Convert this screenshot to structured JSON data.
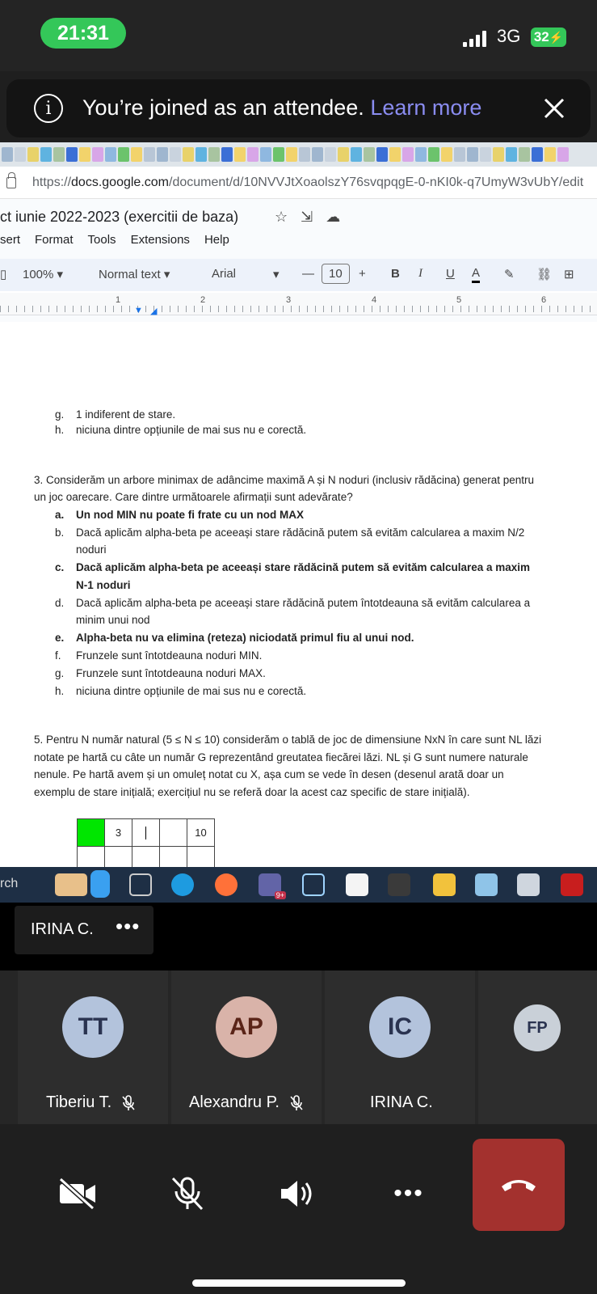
{
  "status_bar": {
    "time": "21:31",
    "network": "3G",
    "battery": "32"
  },
  "banner": {
    "message": "You’re joined as an attendee.",
    "link": "Learn more"
  },
  "browser": {
    "url_prefix": "https://",
    "url_domain": "docs.google.com",
    "url_path": "/document/d/10NVVJtXoaolszY76svqpqgE-0-nKI0k-q7UmyW3vUbY/edit"
  },
  "docs": {
    "title": "ct iunie 2022-2023 (exercitii de baza)",
    "menu": [
      "sert",
      "Format",
      "Tools",
      "Extensions",
      "Help"
    ],
    "toolbar": {
      "zoom": "100%",
      "style": "Normal text",
      "font": "Arial",
      "font_size": "10",
      "minus": "—",
      "plus": "+",
      "bold": "B",
      "italic": "I",
      "underline": "U",
      "text_color": "A"
    },
    "ruler": [
      "1",
      "2",
      "3",
      "4",
      "5",
      "6"
    ]
  },
  "document": {
    "prev_options": [
      {
        "letter": "g.",
        "text": "1 indiferent de stare."
      },
      {
        "letter": "h.",
        "text": "niciuna dintre opțiunile de mai sus nu e corectă."
      }
    ],
    "q3_line1": "3. Considerăm un arbore minimax de adâncime maximă A și N noduri (inclusiv rădăcina) generat pentru",
    "q3_line2": "un joc oarecare. Care dintre următoarele afirmații sunt adevărate?",
    "q3_options": [
      {
        "letter": "a.",
        "text": "Un nod MIN nu poate fi frate cu un nod MAX",
        "bold": true
      },
      {
        "letter": "b.",
        "text": "Dacă aplicăm alpha-beta pe aceeași stare rădăcină putem să evităm calcularea a maxim N/2",
        "text2": "noduri",
        "bold": false
      },
      {
        "letter": "c.",
        "text": "Dacă aplicăm alpha-beta pe aceeași stare rădăcină putem să evităm calcularea a maxim",
        "text2": "N-1 noduri",
        "bold": true
      },
      {
        "letter": "d.",
        "text": "Dacă aplicăm alpha-beta pe aceeași stare rădăcină putem întotdeauna să evităm calcularea a",
        "text2": "minim unui nod",
        "bold": false
      },
      {
        "letter": "e.",
        "text": "Alpha-beta nu va elimina (reteza) niciodată primul fiu al unui nod.",
        "bold": true
      },
      {
        "letter": "f.",
        "text": "Frunzele sunt întotdeauna noduri MIN.",
        "bold": false
      },
      {
        "letter": "g.",
        "text": "Frunzele sunt întotdeauna noduri MAX.",
        "bold": false
      },
      {
        "letter": "h.",
        "text": "niciuna dintre opțiunile de mai sus nu e corectă.",
        "bold": false
      }
    ],
    "q5_lines": [
      "5. Pentru N număr natural (5 ≤ N ≤ 10) considerăm o tablă de joc de dimensiune NxN în care sunt NL lăzi",
      "notate pe hartă cu câte un număr G reprezentând greutatea fiecărei lăzi. NL și G sunt numere naturale",
      "nenule. Pe hartă avem și un omuleț notat cu X, așa cum se vede în desen (desenul arată doar un",
      "exemplu de stare inițială; exercițiul nu se referă doar la acest caz specific de stare inițială)."
    ],
    "grid_row": [
      "",
      "3",
      "",
      "",
      "10"
    ]
  },
  "taskbar": {
    "search": "rch",
    "teams_badge": "9+"
  },
  "meeting": {
    "screen_share_owner": "IRINA C.",
    "more": "•••",
    "participants": [
      {
        "initials": "TT",
        "name": "Tiberiu T.",
        "muted": true,
        "color": "#b3c3dc"
      },
      {
        "initials": "AP",
        "name": "Alexandru P.",
        "muted": true,
        "color": "#d9b3a9"
      },
      {
        "initials": "IC",
        "name": "IRINA C.",
        "muted": false,
        "color": "#b3c3dc"
      },
      {
        "initials": "FP",
        "name": "",
        "muted": false,
        "color": "#c9d0d8"
      }
    ],
    "more_controls": "•••"
  }
}
